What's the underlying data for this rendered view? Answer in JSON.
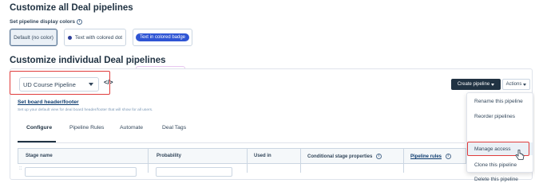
{
  "section1": {
    "title": "Customize all Deal pipelines",
    "subtitle": "Set pipeline display colors",
    "options": [
      {
        "label": "Default (no color)"
      },
      {
        "label": "Text with colored dot"
      },
      {
        "label": "Text in colored badge"
      }
    ]
  },
  "section2": {
    "title": "Customize individual Deal pipelines"
  },
  "pipeline_select": {
    "value": "UD Course Pipeline",
    "embed_icon": "</>"
  },
  "board_header": {
    "link": "Set board header/footer",
    "description": "Set up your default view for deal board header/footer that will show for all users."
  },
  "tabs": [
    "Configure",
    "Pipeline Rules",
    "Automate",
    "Deal Tags"
  ],
  "table": {
    "columns": [
      "Stage name",
      "Probability",
      "Used in",
      "Conditional stage properties",
      "Pipeline rules"
    ],
    "row_prefix": "::"
  },
  "buttons": {
    "create_pipeline": "Create pipeline",
    "actions": "Actions"
  },
  "actions_menu": {
    "items": [
      "Rename this pipeline",
      "Reorder pipelines",
      "Manage access",
      "Clone this pipeline",
      "Delete this pipeline"
    ]
  },
  "colors": {
    "dark_button": "#213343",
    "badge_blue": "#2f55d4",
    "highlight_red": "#e03c3c"
  }
}
